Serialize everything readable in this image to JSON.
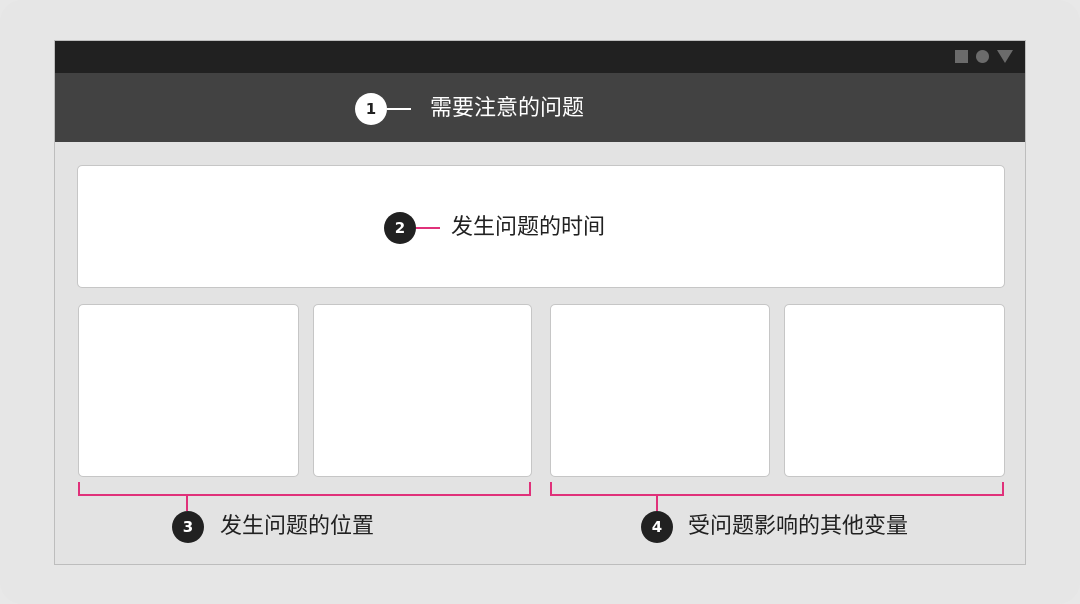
{
  "colors": {
    "accent": "#e0317a",
    "statusbar": "#212121",
    "appbar": "#424242",
    "badge_dark": "#212121"
  },
  "status_icons": [
    "square-icon",
    "circle-icon",
    "triangle-icon"
  ],
  "callouts": [
    {
      "number": "1",
      "text": "需要注意的问题"
    },
    {
      "number": "2",
      "text": "发生问题的时间"
    },
    {
      "number": "3",
      "text": "发生问题的位置"
    },
    {
      "number": "4",
      "text": "受问题影响的其他变量"
    }
  ]
}
